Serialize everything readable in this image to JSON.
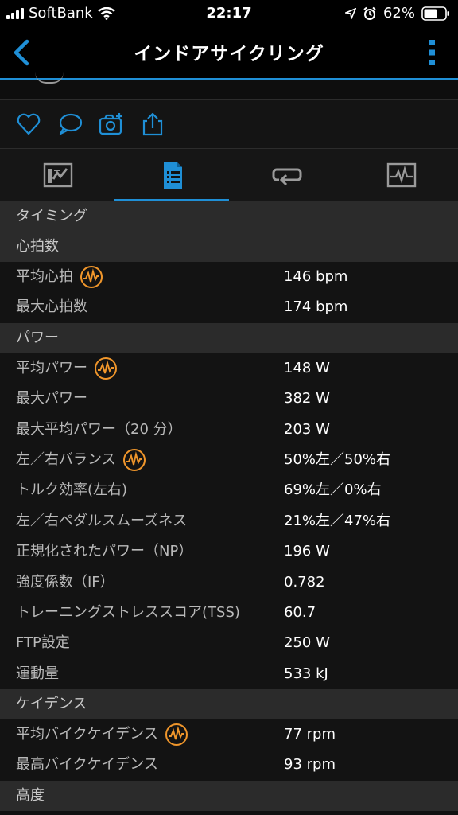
{
  "status_bar": {
    "carrier": "SoftBank",
    "time": "22:17",
    "battery": "62%"
  },
  "nav": {
    "title": "インドアサイクリング"
  },
  "colors": {
    "accent": "#1f8fd6",
    "insight_icon": "#f0962b"
  },
  "tabs": [
    {
      "icon": "chart-summary-icon",
      "active": false
    },
    {
      "icon": "details-list-icon",
      "active": true
    },
    {
      "icon": "laps-loop-icon",
      "active": false
    },
    {
      "icon": "graph-monitor-icon",
      "active": false
    }
  ],
  "sections": {
    "timing": "タイミング",
    "heart_rate": "心拍数",
    "power": "パワー",
    "cadence": "ケイデンス",
    "elevation": "高度"
  },
  "heart_rate": {
    "avg_label": "平均心拍",
    "avg_value": "146 bpm",
    "max_label": "最大心拍数",
    "max_value": "174 bpm"
  },
  "power": {
    "avg_label": "平均パワー",
    "avg_value": "148 W",
    "max_label": "最大パワー",
    "max_value": "382 W",
    "max_avg_label": "最大平均パワー（20 分）",
    "max_avg_value": "203 W",
    "balance_label": "左／右バランス",
    "balance_value": "50%左／50%右",
    "torque_label": "トルク効率(左右)",
    "torque_value": "69%左／0%右",
    "smooth_label": "左／右ペダルスムーズネス",
    "smooth_value": "21%左／47%右",
    "np_label": "正規化されたパワー（NP）",
    "np_value": "196 W",
    "if_label": "強度係数（IF）",
    "if_value": "0.782",
    "tss_label": "トレーニングストレススコア(TSS)",
    "tss_value": "60.7",
    "ftp_label": "FTP設定",
    "ftp_value": "250 W",
    "work_label": "運動量",
    "work_value": "533 kJ"
  },
  "cadence": {
    "avg_label": "平均バイクケイデンス",
    "avg_value": "77 rpm",
    "max_label": "最高バイクケイデンス",
    "max_value": "93 rpm"
  }
}
